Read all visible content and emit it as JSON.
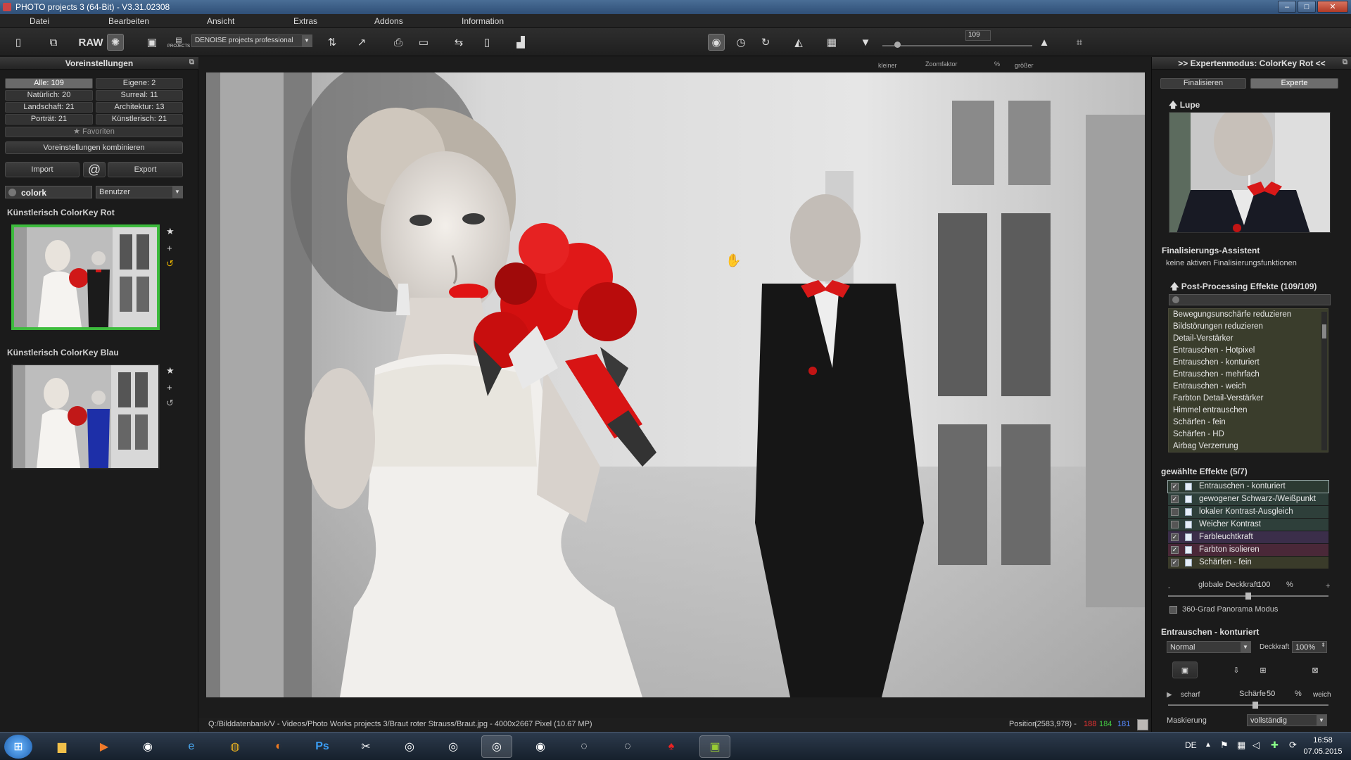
{
  "window": {
    "title": "PHOTO projects 3 (64-Bit) - V3.31.02308",
    "min": "–",
    "max": "□",
    "close": "✕"
  },
  "menu": [
    "Datei",
    "Bearbeiten",
    "Ansicht",
    "Extras",
    "Addons",
    "Information"
  ],
  "toolbar": {
    "raw_label": "RAW",
    "projects_label": "PROJECTS",
    "preset_select": "DENOISE projects professional",
    "zoom_smaller": "kleiner",
    "zoom_label": "Zoomfaktor",
    "zoom_value": "109",
    "zoom_unit": "%",
    "zoom_bigger": "größer"
  },
  "left": {
    "header": "Voreinstellungen",
    "categories": [
      "Alle: 109",
      "Eigene: 2",
      "Natürlich: 20",
      "Surreal: 11",
      "Landschaft: 21",
      "Architektur: 13",
      "Porträt: 21",
      "Künstlerisch: 21"
    ],
    "favorites": "Favoriten",
    "combine": "Voreinstellungen kombinieren",
    "import": "Import",
    "at": "@",
    "export": "Export",
    "search_value": "colork",
    "user_select": "Benutzer",
    "preset1": "Künstlerisch ColorKey Rot",
    "preset2": "Künstlerisch ColorKey Blau"
  },
  "status": {
    "path": "Q:/Bilddatenbank/V - Videos/Photo Works projects 3/Braut roter Strauss/Braut.jpg - 4000x2667 Pixel (10.67 MP)",
    "position_label": "Position",
    "position_value": "(2583,978) -",
    "r": "188",
    "g": "184",
    "b": "181"
  },
  "right": {
    "header": ">> Expertenmodus: ColorKey Rot <<",
    "tab_finalize": "Finalisieren",
    "tab_expert": "Experte",
    "lupe": "Lupe",
    "assistant_title": "Finalisierungs-Assistent",
    "assistant_text": "keine aktiven Finalisierungsfunktionen",
    "post_title": "Post-Processing Effekte (109/109)",
    "post_items": [
      "Bewegungsunschärfe reduzieren",
      "Bildstörungen reduzieren",
      "Detail-Verstärker",
      "Entrauschen - Hotpixel",
      "Entrauschen - konturiert",
      "Entrauschen - mehrfach",
      "Entrauschen - weich",
      "Farbton Detail-Verstärker",
      "Himmel entrauschen",
      "Schärfen - fein",
      "Schärfen - HD",
      "Airbag Verzerrung"
    ],
    "chosen_title": "gewählte Effekte (5/7)",
    "chosen": [
      {
        "label": "Entrauschen - konturiert",
        "checked": true,
        "bg": "#2c3a32"
      },
      {
        "label": "gewogener Schwarz-/Weißpunkt",
        "checked": true,
        "bg": "#2e3f3a"
      },
      {
        "label": "lokaler Kontrast-Ausgleich",
        "checked": false,
        "bg": "#2e3f3a"
      },
      {
        "label": "Weicher Kontrast",
        "checked": false,
        "bg": "#2e3f3a"
      },
      {
        "label": "Farbleuchtkraft",
        "checked": true,
        "bg": "#3b2e4a"
      },
      {
        "label": "Farbton isolieren",
        "checked": true,
        "bg": "#4a2838"
      },
      {
        "label": "Schärfen - fein",
        "checked": true,
        "bg": "#3a3b2a"
      }
    ],
    "opacity_label": "globale Deckkraft",
    "opacity_value": "100",
    "opacity_unit": "%",
    "minus": "-",
    "plus": "+",
    "panorama": "360-Grad Panorama Modus",
    "effect_title": "Entrauschen - konturiert",
    "blend_select": "Normal",
    "deckkraft_label": "Deckkraft",
    "deckkraft_value": "100%",
    "sharp": "scharf",
    "schaerfe_label": "Schärfe",
    "schaerfe_value": "50",
    "schaerfe_unit": "%",
    "soft": "weich",
    "mask_label": "Maskierung",
    "mask_value": "vollständig"
  },
  "taskbar": {
    "lang": "DE",
    "time": "16:58",
    "date": "07.05.2015"
  }
}
